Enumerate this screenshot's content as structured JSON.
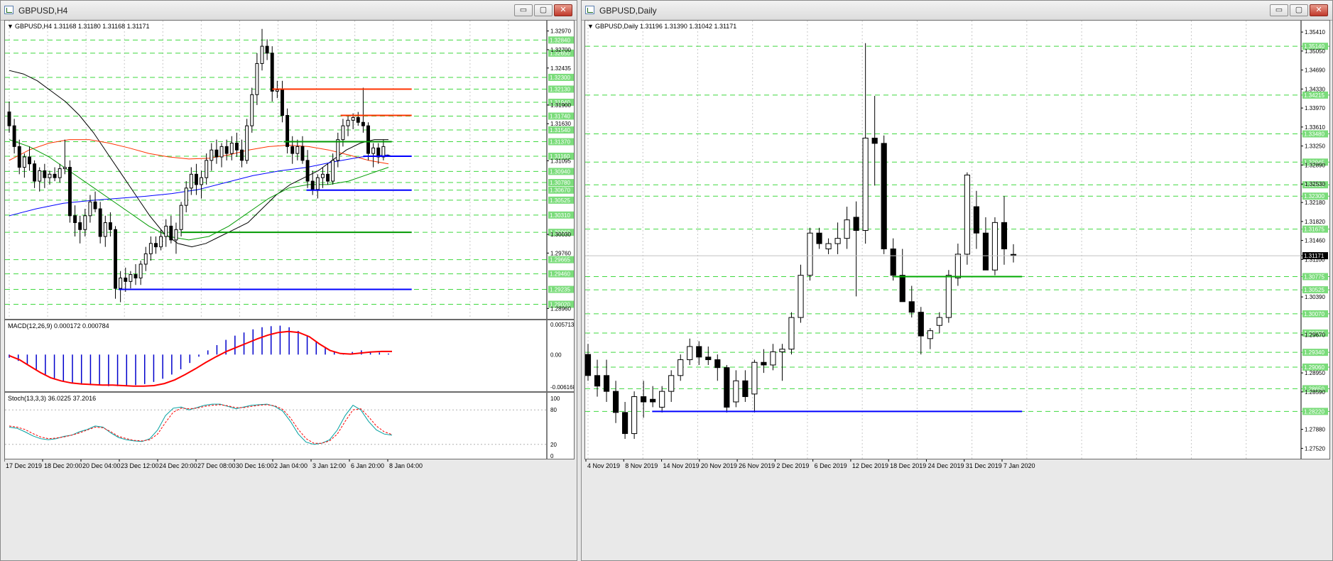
{
  "left_window": {
    "title": "GBPUSD,H4",
    "chart_header": "GBPUSD,H4  1.31168 1.31180 1.31168 1.31171",
    "macd_header": "MACD(12,26,9) 0.000172 0.000784",
    "stoch_header": "Stoch(13,3,3) 36.0225 37.2016"
  },
  "right_window": {
    "title": "GBPUSD,Daily",
    "chart_header": "GBPUSD,Daily  1.31196 1.31390 1.31042 1.31171"
  },
  "window_buttons": {
    "minimize": "▭",
    "maximize": "▢",
    "close": "✕"
  },
  "colors": {
    "grid_green": "#00cc00",
    "price_label_bg": "#7bdc7b",
    "candle_bear": "#000000",
    "sma_black": "#000000",
    "sma_red": "#ff3300",
    "sma_blue": "#0000ff",
    "sma_green": "#009900",
    "macd_hist": "#0000cc",
    "macd_signal": "#ff0000",
    "stoch_main": "#00a0a0",
    "stoch_signal": "#ff0000"
  },
  "chart_data": [
    {
      "type": "candlestick",
      "title": "GBPUSD,H4",
      "symbol": "GBPUSD",
      "timeframe": "H4",
      "ohlc_current": {
        "open": 1.31168,
        "high": 1.3118,
        "low": 1.31168,
        "close": 1.31171
      },
      "ylim": [
        1.2883,
        1.331
      ],
      "y_ticks": [
        "1.32970",
        "1.32700",
        "1.32435",
        "1.31900",
        "1.31630",
        "1.31095",
        "1.30030",
        "1.29760",
        "1.28960"
      ],
      "x_ticks": [
        "17 Dec 2019",
        "18 Dec 20:00",
        "20 Dec 04:00",
        "23 Dec 12:00",
        "24 Dec 20:00",
        "27 Dec 08:00",
        "30 Dec 16:00",
        "2 Jan 04:00",
        "3 Jan 12:00",
        "6 Jan 20:00",
        "8 Jan 04:00"
      ],
      "level_labels": [
        "1.32840",
        "1.32650",
        "1.32300",
        "1.32130",
        "1.31940",
        "1.31740",
        "1.31540",
        "1.31370",
        "1.31160",
        "1.30940",
        "1.30780",
        "1.30670",
        "1.30525",
        "1.30310",
        "1.30060",
        "1.29665",
        "1.29460",
        "1.29235",
        "1.29020"
      ],
      "lines": [
        {
          "color": "#ff3300",
          "y": 1.3213
        },
        {
          "color": "#ff3300",
          "y": 1.3175
        },
        {
          "color": "#009900",
          "y": 1.3137
        },
        {
          "color": "#0000ff",
          "y": 1.3116
        },
        {
          "color": "#0000ff",
          "y": 1.3067
        },
        {
          "color": "#009900",
          "y": 1.3006
        },
        {
          "color": "#0000ff",
          "y": 1.29235
        }
      ],
      "candles": [
        [
          1.318,
          1.3195,
          1.315,
          1.316
        ],
        [
          1.316,
          1.317,
          1.312,
          1.313
        ],
        [
          1.313,
          1.314,
          1.309,
          1.31
        ],
        [
          1.31,
          1.312,
          1.3085,
          1.3115
        ],
        [
          1.3115,
          1.313,
          1.3095,
          1.3105
        ],
        [
          1.3105,
          1.311,
          1.307,
          1.308
        ],
        [
          1.308,
          1.31,
          1.3065,
          1.3095
        ],
        [
          1.3095,
          1.3105,
          1.307,
          1.3085
        ],
        [
          1.3085,
          1.3095,
          1.3075,
          1.309
        ],
        [
          1.309,
          1.31,
          1.308,
          1.3085
        ],
        [
          1.3085,
          1.3105,
          1.3078,
          1.3098
        ],
        [
          1.3098,
          1.314,
          1.309,
          1.31
        ],
        [
          1.31,
          1.311,
          1.302,
          1.303
        ],
        [
          1.303,
          1.3045,
          1.3,
          1.302
        ],
        [
          1.302,
          1.303,
          1.299,
          1.301
        ],
        [
          1.301,
          1.304,
          1.3,
          1.303
        ],
        [
          1.303,
          1.306,
          1.302,
          1.305
        ],
        [
          1.305,
          1.3065,
          1.3035,
          1.304
        ],
        [
          1.304,
          1.305,
          1.299,
          1.3
        ],
        [
          1.3,
          1.303,
          1.2985,
          1.302
        ],
        [
          1.302,
          1.3035,
          1.3,
          1.301
        ],
        [
          1.301,
          1.3015,
          1.291,
          1.2925
        ],
        [
          1.2925,
          1.295,
          1.2905,
          1.294
        ],
        [
          1.294,
          1.2955,
          1.292,
          1.2935
        ],
        [
          1.2935,
          1.295,
          1.2925,
          1.2945
        ],
        [
          1.2945,
          1.296,
          1.293,
          1.294
        ],
        [
          1.294,
          1.2965,
          1.293,
          1.296
        ],
        [
          1.296,
          1.2985,
          1.295,
          1.2975
        ],
        [
          1.2975,
          1.3,
          1.2965,
          1.299
        ],
        [
          1.299,
          1.3,
          1.2975,
          1.2985
        ],
        [
          1.2985,
          1.301,
          1.298,
          1.3
        ],
        [
          1.3,
          1.3025,
          1.2985,
          1.3015
        ],
        [
          1.3015,
          1.303,
          1.299,
          1.2995
        ],
        [
          1.2995,
          1.302,
          1.2975,
          1.301
        ],
        [
          1.301,
          1.305,
          1.3,
          1.3045
        ],
        [
          1.3045,
          1.308,
          1.3035,
          1.307
        ],
        [
          1.307,
          1.31,
          1.306,
          1.309
        ],
        [
          1.309,
          1.3105,
          1.306,
          1.3075
        ],
        [
          1.3075,
          1.3095,
          1.3055,
          1.3085
        ],
        [
          1.3085,
          1.312,
          1.3075,
          1.311
        ],
        [
          1.311,
          1.3135,
          1.3095,
          1.3125
        ],
        [
          1.3125,
          1.314,
          1.3105,
          1.3115
        ],
        [
          1.3115,
          1.3135,
          1.31,
          1.313
        ],
        [
          1.313,
          1.314,
          1.311,
          1.312
        ],
        [
          1.312,
          1.3145,
          1.311,
          1.3135
        ],
        [
          1.3135,
          1.315,
          1.3115,
          1.3125
        ],
        [
          1.3125,
          1.314,
          1.31,
          1.311
        ],
        [
          1.311,
          1.317,
          1.3105,
          1.316
        ],
        [
          1.316,
          1.3215,
          1.315,
          1.3205
        ],
        [
          1.3205,
          1.3265,
          1.319,
          1.325
        ],
        [
          1.325,
          1.33,
          1.324,
          1.3275
        ],
        [
          1.3275,
          1.3285,
          1.3255,
          1.3265
        ],
        [
          1.3265,
          1.3275,
          1.3195,
          1.321
        ],
        [
          1.321,
          1.3225,
          1.32,
          1.3212
        ],
        [
          1.3212,
          1.3225,
          1.3165,
          1.3175
        ],
        [
          1.3175,
          1.3185,
          1.312,
          1.313
        ],
        [
          1.313,
          1.3145,
          1.3105,
          1.312
        ],
        [
          1.312,
          1.314,
          1.311,
          1.313
        ],
        [
          1.313,
          1.3145,
          1.3105,
          1.311
        ],
        [
          1.311,
          1.3125,
          1.307,
          1.308
        ],
        [
          1.308,
          1.3095,
          1.306,
          1.3068
        ],
        [
          1.3068,
          1.309,
          1.3055,
          1.3085
        ],
        [
          1.3085,
          1.31,
          1.307,
          1.309
        ],
        [
          1.309,
          1.3105,
          1.3075,
          1.308
        ],
        [
          1.308,
          1.312,
          1.3075,
          1.311
        ],
        [
          1.311,
          1.315,
          1.31,
          1.314
        ],
        [
          1.314,
          1.317,
          1.313,
          1.316
        ],
        [
          1.316,
          1.3175,
          1.3145,
          1.3168
        ],
        [
          1.3168,
          1.3178,
          1.3155,
          1.3172
        ],
        [
          1.3172,
          1.318,
          1.316,
          1.3165
        ],
        [
          1.3165,
          1.3215,
          1.315,
          1.316
        ],
        [
          1.316,
          1.3165,
          1.311,
          1.312
        ],
        [
          1.312,
          1.3135,
          1.31,
          1.3128
        ],
        [
          1.3128,
          1.3135,
          1.3105,
          1.3115
        ],
        [
          1.3115,
          1.314,
          1.311,
          1.313
        ],
        [
          1.31168,
          1.3118,
          1.31168,
          1.31171
        ]
      ],
      "sma_black": [
        1.324,
        1.3235,
        1.3225,
        1.321,
        1.3195,
        1.3175,
        1.315,
        1.312,
        1.309,
        1.306,
        1.303,
        1.3005,
        1.299,
        1.2985,
        1.299,
        1.3,
        1.301,
        1.302,
        1.304,
        1.306,
        1.3075,
        1.3085,
        1.3095,
        1.311,
        1.3125,
        1.3135,
        1.314,
        1.314
      ],
      "sma_red": [
        1.311,
        1.3125,
        1.3135,
        1.314,
        1.314,
        1.3135,
        1.3128,
        1.312,
        1.3115,
        1.3112,
        1.3113,
        1.3118,
        1.3125,
        1.313,
        1.3132,
        1.313,
        1.3125,
        1.3118,
        1.311,
        1.3105
      ],
      "sma_blue": [
        1.303,
        1.304,
        1.3048,
        1.3052,
        1.3055,
        1.3058,
        1.3062,
        1.3068,
        1.3078,
        1.3088,
        1.3095,
        1.31,
        1.3108,
        1.3115,
        1.3118
      ],
      "sma_green": [
        1.314,
        1.313,
        1.3115,
        1.3095,
        1.3075,
        1.3055,
        1.3035,
        1.3015,
        1.3,
        1.2995,
        1.3,
        1.3015,
        1.3035,
        1.3055,
        1.307,
        1.3075,
        1.3075,
        1.308,
        1.309,
        1.31
      ]
    },
    {
      "type": "bar",
      "title": "MACD(12,26,9) 0.000172 0.000784",
      "ylim": [
        -0.006168,
        0.005713
      ],
      "y_ticks": [
        "0.005713",
        "0.00",
        "-0.006168"
      ],
      "histogram": [
        -0.0006,
        -0.0012,
        -0.002,
        -0.003,
        -0.0038,
        -0.0045,
        -0.005,
        -0.0054,
        -0.0057,
        -0.0058,
        -0.0059,
        -0.006,
        -0.006,
        -0.0059,
        -0.0058,
        -0.0056,
        -0.0052,
        -0.0046,
        -0.0038,
        -0.0028,
        -0.0016,
        -0.0004,
        0.0008,
        0.0018,
        0.0028,
        0.0036,
        0.0042,
        0.0048,
        0.0052,
        0.0054,
        0.0055,
        0.0052,
        0.0045,
        0.0035,
        0.0024,
        0.0014,
        0.0006,
        0.0003,
        0.0005,
        0.0008,
        0.0006,
        0.0004,
        0.0002
      ],
      "signal": [
        -0.0002,
        -0.001,
        -0.0022,
        -0.0034,
        -0.0044,
        -0.005,
        -0.0054,
        -0.0056,
        -0.0057,
        -0.0058,
        -0.0058,
        -0.0059,
        -0.006,
        -0.006,
        -0.0059,
        -0.0055,
        -0.0048,
        -0.0038,
        -0.0027,
        -0.0015,
        -0.0004,
        0.0006,
        0.0014,
        0.0022,
        0.003,
        0.0037,
        0.0042,
        0.0044,
        0.0042,
        0.0034,
        0.002,
        0.0008,
        0.0002,
        0.0001,
        0.0003,
        0.0005,
        0.0006,
        0.0006
      ]
    },
    {
      "type": "line",
      "title": "Stoch(13,3,3) 36.0225 37.2016",
      "ylim": [
        0,
        100
      ],
      "y_ticks": [
        "100",
        "80",
        "20",
        "0"
      ],
      "main": [
        50,
        48,
        42,
        35,
        30,
        28,
        30,
        34,
        36,
        42,
        46,
        52,
        50,
        40,
        32,
        28,
        26,
        25,
        30,
        45,
        70,
        83,
        85,
        80,
        84,
        88,
        90,
        90,
        86,
        82,
        85,
        88,
        89,
        90,
        86,
        78,
        60,
        38,
        24,
        20,
        22,
        28,
        45,
        70,
        88,
        80,
        60,
        45,
        38,
        36
      ],
      "signal": [
        52,
        50,
        46,
        39,
        33,
        30,
        31,
        33,
        36,
        40,
        45,
        50,
        49,
        42,
        34,
        30,
        27,
        26,
        28,
        38,
        58,
        76,
        83,
        82,
        83,
        86,
        88,
        89,
        87,
        84,
        84,
        86,
        88,
        89,
        87,
        81,
        66,
        46,
        30,
        22,
        22,
        26,
        38,
        60,
        80,
        82,
        68,
        52,
        42,
        37
      ]
    },
    {
      "type": "candlestick",
      "title": "GBPUSD,Daily",
      "symbol": "GBPUSD",
      "timeframe": "Daily",
      "ohlc_current": {
        "open": 1.31196,
        "high": 1.3139,
        "low": 1.31042,
        "close": 1.31171
      },
      "ylim": [
        1.2735,
        1.356
      ],
      "y_ticks": [
        "1.35410",
        "1.35050",
        "1.34690",
        "1.34330",
        "1.33970",
        "1.33610",
        "1.33250",
        "1.32890",
        "1.32530",
        "1.32180",
        "1.31820",
        "1.31460",
        "1.31171",
        "1.31100",
        "1.30390",
        "1.29670",
        "1.28950",
        "1.28590",
        "1.27880",
        "1.27520"
      ],
      "x_ticks": [
        "4 Nov 2019",
        "8 Nov 2019",
        "14 Nov 2019",
        "20 Nov 2019",
        "26 Nov 2019",
        "2 Dec 2019",
        "6 Dec 2019",
        "12 Dec 2019",
        "18 Dec 2019",
        "24 Dec 2019",
        "31 Dec 2019",
        "7 Jan 2020"
      ],
      "level_labels": [
        "1.35140",
        "1.34215",
        "1.33480",
        "1.32945",
        "1.32515",
        "1.32300",
        "1.31675",
        "1.30775",
        "1.30525",
        "1.30070",
        "1.29705",
        "1.29340",
        "1.29060",
        "1.28650",
        "1.28220"
      ],
      "current_price_label": "1.31171",
      "lines": [
        {
          "color": "#00aa00",
          "y": 1.30775
        },
        {
          "color": "#0000ff",
          "y": 1.2822
        }
      ],
      "candles": [
        [
          1.293,
          1.295,
          1.288,
          1.289
        ],
        [
          1.289,
          1.292,
          1.285,
          1.287
        ],
        [
          1.289,
          1.292,
          1.284,
          1.286
        ],
        [
          1.286,
          1.288,
          1.28,
          1.282
        ],
        [
          1.282,
          1.284,
          1.277,
          1.278
        ],
        [
          1.278,
          1.286,
          1.277,
          1.285
        ],
        [
          1.285,
          1.288,
          1.281,
          1.284
        ],
        [
          1.2845,
          1.287,
          1.283,
          1.284
        ],
        [
          1.283,
          1.287,
          1.282,
          1.286
        ],
        [
          1.286,
          1.29,
          1.284,
          1.289
        ],
        [
          1.289,
          1.293,
          1.288,
          1.292
        ],
        [
          1.292,
          1.296,
          1.291,
          1.2945
        ],
        [
          1.2945,
          1.2955,
          1.291,
          1.2925
        ],
        [
          1.2925,
          1.2945,
          1.291,
          1.292
        ],
        [
          1.292,
          1.293,
          1.288,
          1.2905
        ],
        [
          1.2905,
          1.291,
          1.282,
          1.283
        ],
        [
          1.284,
          1.29,
          1.283,
          1.288
        ],
        [
          1.288,
          1.29,
          1.284,
          1.285
        ],
        [
          1.2855,
          1.292,
          1.282,
          1.2915
        ],
        [
          1.2915,
          1.294,
          1.2895,
          1.291
        ],
        [
          1.291,
          1.295,
          1.29,
          1.2935
        ],
        [
          1.2935,
          1.295,
          1.288,
          1.294
        ],
        [
          1.294,
          1.301,
          1.293,
          1.3
        ],
        [
          1.3,
          1.31,
          1.299,
          1.308
        ],
        [
          1.308,
          1.317,
          1.307,
          1.316
        ],
        [
          1.316,
          1.317,
          1.313,
          1.314
        ],
        [
          1.313,
          1.315,
          1.312,
          1.314
        ],
        [
          1.314,
          1.318,
          1.312,
          1.315
        ],
        [
          1.315,
          1.321,
          1.313,
          1.3185
        ],
        [
          1.319,
          1.322,
          1.304,
          1.3165
        ],
        [
          1.3165,
          1.352,
          1.314,
          1.334
        ],
        [
          1.334,
          1.342,
          1.325,
          1.333
        ],
        [
          1.333,
          1.3345,
          1.312,
          1.313
        ],
        [
          1.313,
          1.315,
          1.307,
          1.308
        ],
        [
          1.308,
          1.313,
          1.305,
          1.303
        ],
        [
          1.303,
          1.306,
          1.3,
          1.301
        ],
        [
          1.301,
          1.302,
          1.293,
          1.2965
        ],
        [
          1.296,
          1.298,
          1.294,
          1.2975
        ],
        [
          1.2985,
          1.301,
          1.297,
          1.3
        ],
        [
          1.3,
          1.309,
          1.299,
          1.308
        ],
        [
          1.3075,
          1.314,
          1.306,
          1.312
        ],
        [
          1.312,
          1.3275,
          1.31,
          1.327
        ],
        [
          1.321,
          1.324,
          1.313,
          1.316
        ],
        [
          1.316,
          1.319,
          1.309,
          1.309
        ],
        [
          1.309,
          1.319,
          1.308,
          1.318
        ],
        [
          1.318,
          1.323,
          1.31,
          1.313
        ],
        [
          1.31196,
          1.3139,
          1.31042,
          1.31171
        ]
      ]
    }
  ]
}
